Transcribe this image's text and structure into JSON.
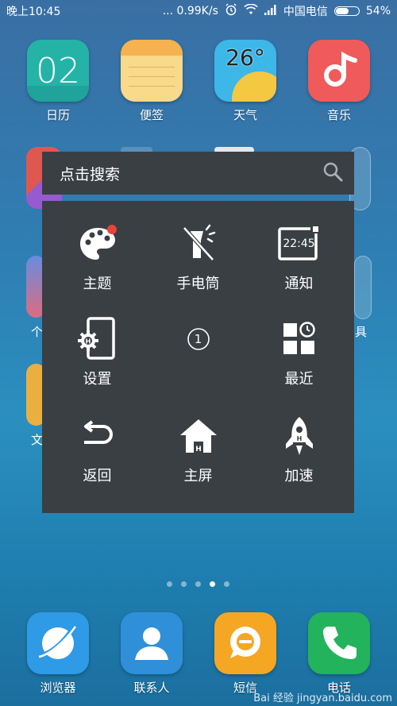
{
  "status_bar": {
    "time": "晚上10:45",
    "net_speed": "... 0.99K/s",
    "carrier": "中国电信",
    "battery_percent": "54%",
    "battery_level": 0.54
  },
  "apps_row1": [
    {
      "label": "日历",
      "icon": "calendar-icon",
      "tile_text": "02",
      "color": "#1fa39a"
    },
    {
      "label": "便签",
      "icon": "notes-icon",
      "tile_text": "",
      "color": "#f7c76a"
    },
    {
      "label": "天气",
      "icon": "weather-icon",
      "tile_text": "26°",
      "color": "#3cb7e8"
    },
    {
      "label": "音乐",
      "icon": "music-icon",
      "tile_text": "",
      "color": "#f05a5a"
    }
  ],
  "dock": [
    {
      "label": "浏览器",
      "icon": "browser-icon",
      "color": "#2f9ae6"
    },
    {
      "label": "联系人",
      "icon": "contacts-icon",
      "color": "#2f8fd9"
    },
    {
      "label": "短信",
      "icon": "sms-icon",
      "color": "#f5a623"
    },
    {
      "label": "电话",
      "icon": "phone-icon",
      "color": "#22b35c"
    }
  ],
  "partial_labels": {
    "left_row3": "个",
    "right_row3": "具",
    "left_row4": "文"
  },
  "search": {
    "placeholder": "点击搜索",
    "icon": "search-icon"
  },
  "quick_menu": [
    {
      "label": "主题",
      "icon": "palette-icon"
    },
    {
      "label": "手电筒",
      "icon": "flashlight-icon"
    },
    {
      "label": "通知",
      "icon": "notification-icon",
      "icon_text": "22:45"
    },
    {
      "label": "设置",
      "icon": "settings-icon"
    },
    {
      "label": "",
      "icon": "number-badge-icon",
      "icon_text": "1"
    },
    {
      "label": "最近",
      "icon": "recent-icon"
    },
    {
      "label": "返回",
      "icon": "back-icon"
    },
    {
      "label": "主屏",
      "icon": "home-icon"
    },
    {
      "label": "加速",
      "icon": "rocket-icon"
    }
  ],
  "page_indicator": {
    "count": 5,
    "active_index": 3
  },
  "watermark": "Bai 经验 jingyan.baidu.com"
}
